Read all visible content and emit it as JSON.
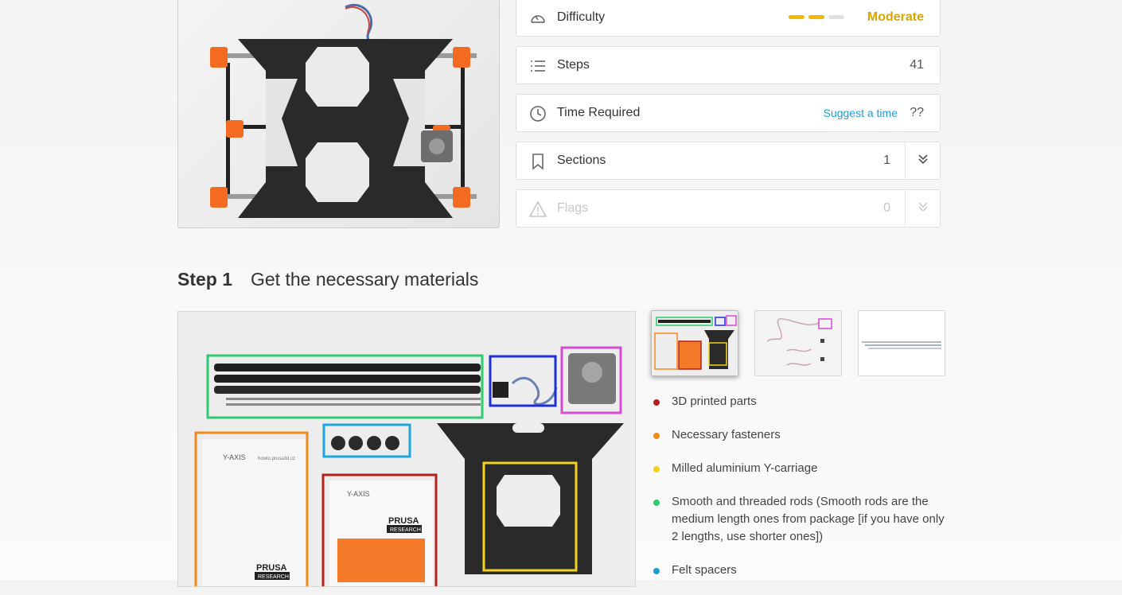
{
  "stats": {
    "difficulty": {
      "label": "Difficulty",
      "value": "Moderate",
      "bar_colors": [
        "#f2b800",
        "#f2b800",
        "#e0e0e0"
      ]
    },
    "steps": {
      "label": "Steps",
      "value": "41"
    },
    "time": {
      "label": "Time Required",
      "link": "Suggest a time",
      "value": "??"
    },
    "sections": {
      "label": "Sections",
      "value": "1"
    },
    "flags": {
      "label": "Flags",
      "value": "0"
    }
  },
  "step": {
    "number": "Step 1",
    "title": "Get the necessary materials"
  },
  "image_text": {
    "sheet_title": "Y-AXIS",
    "sheet_url": "howto.prusa3d.cz",
    "brand": "PRUSA",
    "brand_sub": "RESEARCH"
  },
  "bullets": [
    {
      "text": "3D printed parts",
      "color": "#b3221a"
    },
    {
      "text": "Necessary fasteners",
      "color": "#f28b1e"
    },
    {
      "text": "Milled aluminium Y-carriage",
      "color": "#f2d21e"
    },
    {
      "text": "Smooth and threaded rods (Smooth rods are the medium length ones from package [if you have only 2 lengths, use shorter ones])",
      "color": "#2ecc71"
    },
    {
      "text": "Felt spacers",
      "color": "#1e9bd7"
    }
  ],
  "icons": {
    "difficulty": "gauge-icon",
    "steps": "list-icon",
    "time": "clock-icon",
    "sections": "bookmark-icon",
    "flags": "warning-icon",
    "expand": "double-chevron-down-icon"
  }
}
